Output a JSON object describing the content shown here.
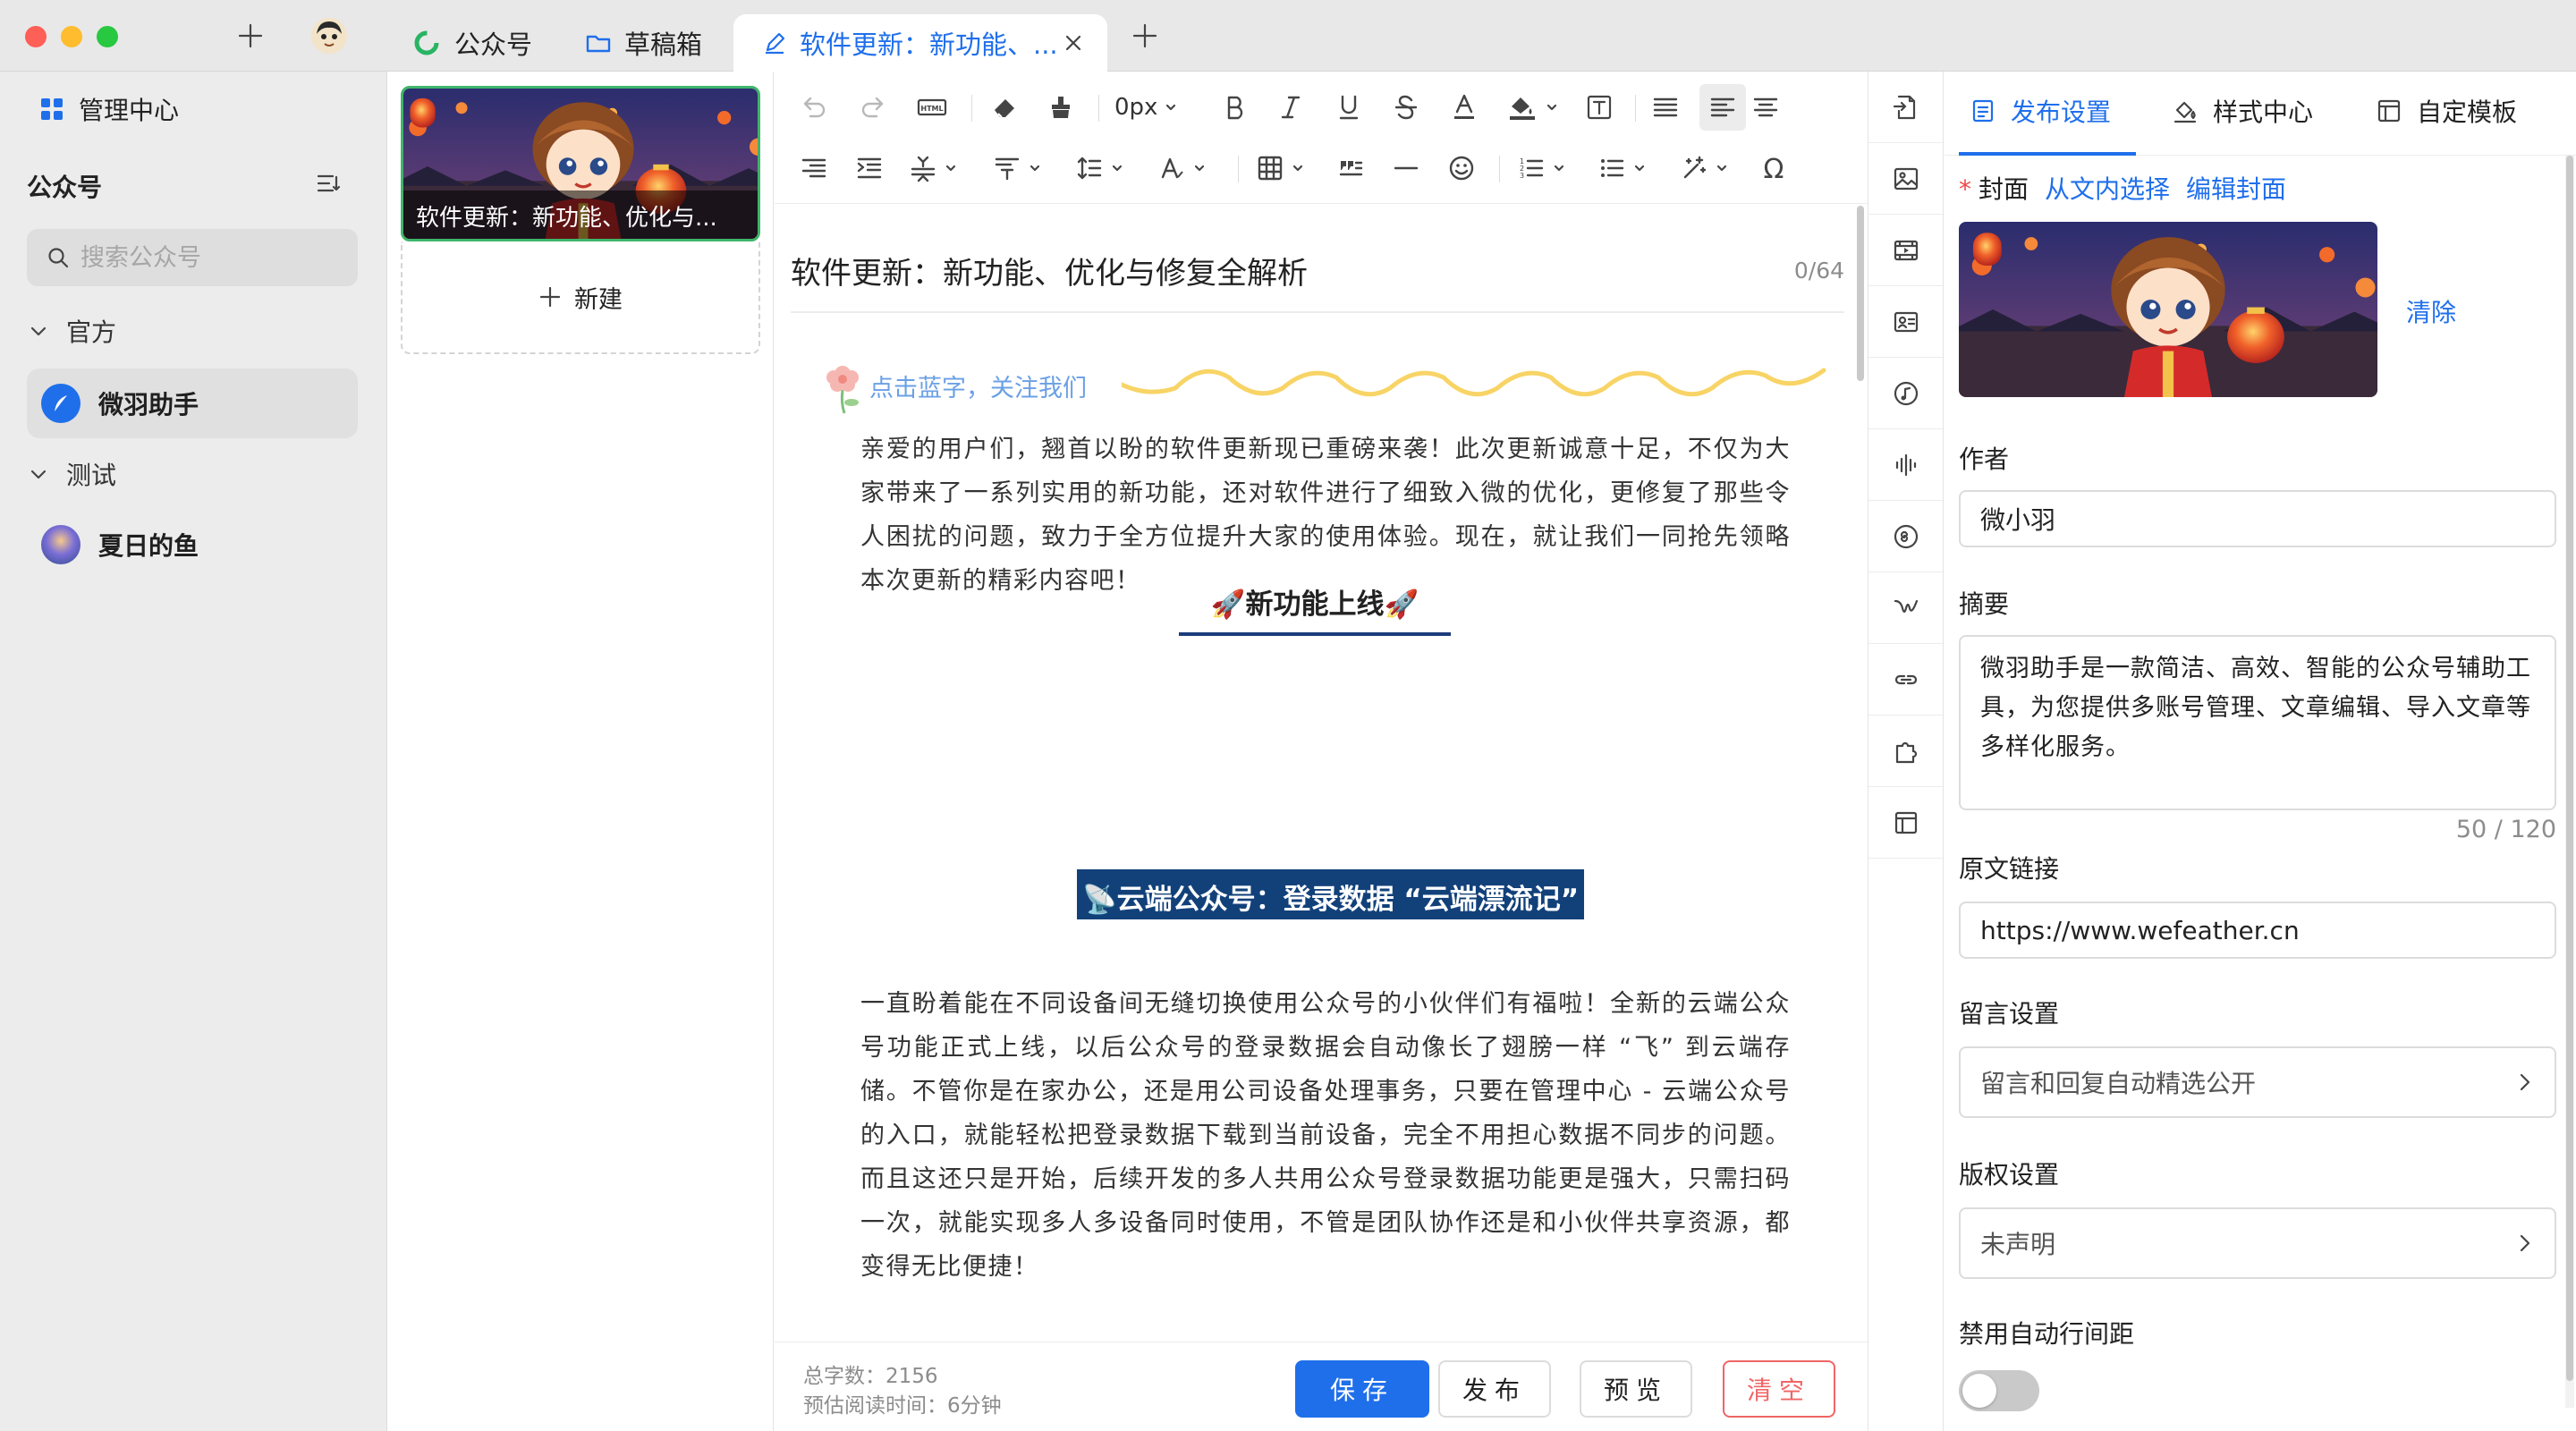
{
  "titlebar": {
    "tabs": [
      {
        "label": "公众号",
        "icon": "wechat-icon"
      },
      {
        "label": "草稿箱",
        "icon": "folder-icon"
      },
      {
        "label": "软件更新：新功能、...",
        "icon": "edit-icon",
        "active": true
      }
    ]
  },
  "sidebar": {
    "admin_label": "管理中心",
    "section_title": "公众号",
    "search_placeholder": "搜索公众号",
    "groups": [
      {
        "label": "官方",
        "accounts": [
          {
            "name": "微羽助手",
            "selected": true
          }
        ]
      },
      {
        "label": "测试",
        "accounts": [
          {
            "name": "夏日的鱼"
          }
        ]
      }
    ]
  },
  "article_list": {
    "items": [
      {
        "title": "软件更新：新功能、优化与..."
      }
    ],
    "new_label": "新建"
  },
  "toolbar": {
    "font_size": "0px",
    "icons": [
      "undo-icon",
      "redo-icon",
      "html-icon",
      "eraser-icon",
      "format-brush-icon",
      "font-size-dropdown",
      "bold-icon",
      "italic-icon",
      "underline-icon",
      "strikethrough-icon",
      "font-color-icon",
      "highlight-icon",
      "textbox-icon",
      "align-justify-icon",
      "align-left-icon",
      "align-center-icon",
      "align-right-icon",
      "indent-icon",
      "letter-spacing-icon",
      "paragraph-spacing-icon",
      "line-height-icon",
      "font-size-adjust-icon",
      "table-icon",
      "quote-icon",
      "horizontal-rule-icon",
      "emoji-icon",
      "ordered-list-icon",
      "unordered-list-icon",
      "magic-icon",
      "special-char-icon"
    ]
  },
  "editor": {
    "title": "软件更新：新功能、优化与修复全解析",
    "title_count": "0/64",
    "follow_text": "点击蓝字，关注我们",
    "intro": "亲爱的用户们，翘首以盼的软件更新现已重磅来袭！此次更新诚意十足，不仅为大家带来了一系列实用的新功能，还对软件进行了细致入微的优化，更修复了那些令人困扰的问题，致力于全方位提升大家的使用体验。现在，就让我们一同抢先领略本次更新的精彩内容吧！",
    "heading": "🚀新功能上线🚀",
    "subheading": "📡云端公众号：登录数据 “云端漂流记”",
    "body": "一直盼着能在不同设备间无缝切换使用公众号的小伙伴们有福啦！全新的云端公众号功能正式上线，以后公众号的登录数据会自动像长了翅膀一样 “飞” 到云端存储。不管你是在家办公，还是用公司设备处理事务，只要在管理中心 - 云端公众号的入口，就能轻松把登录数据下载到当前设备，完全不用担心数据不同步的问题。而且这还只是开始，后续开发的多人共用公众号登录数据功能更是强大，只需扫码一次，就能实现多人多设备同时使用，不管是团队协作还是和小伙伴共享资源，都变得无比便捷！",
    "word_count": "总字数：2156",
    "read_time": "预估阅读时间：6分钟",
    "buttons": {
      "save": "保存",
      "publish": "发布",
      "preview": "预览",
      "clear": "清空"
    }
  },
  "icon_column": [
    "import-icon",
    "image-icon",
    "video-icon",
    "card-icon",
    "music-icon",
    "audio-icon",
    "mini-program-icon",
    "weapp-icon",
    "link-icon",
    "plugin-icon",
    "template-icon"
  ],
  "right_panel": {
    "tabs": [
      "发布设置",
      "样式中心",
      "自定模板"
    ],
    "cover_label": "封面",
    "cover_from_text": "从文内选择",
    "cover_edit": "编辑封面",
    "cover_clear": "清除",
    "author_label": "作者",
    "author_value": "微小羽",
    "summary_label": "摘要",
    "summary_value": "微羽助手是一款简洁、高效、智能的公众号辅助工具，为您提供多账号管理、文章编辑、导入文章等多样化服务。",
    "summary_count": "50 / 120",
    "url_label": "原文链接",
    "url_value": "https://www.wefeather.cn",
    "comment_label": "留言设置",
    "comment_value": "留言和回复自动精选公开",
    "copyright_label": "版权设置",
    "copyright_value": "未声明",
    "line_height_label": "禁用自动行间距",
    "line_height_enabled": false
  },
  "colors": {
    "accent": "#1f6feb",
    "danger": "#f06565",
    "selection": "#3fb56a",
    "heading_bg": "#12417a"
  }
}
